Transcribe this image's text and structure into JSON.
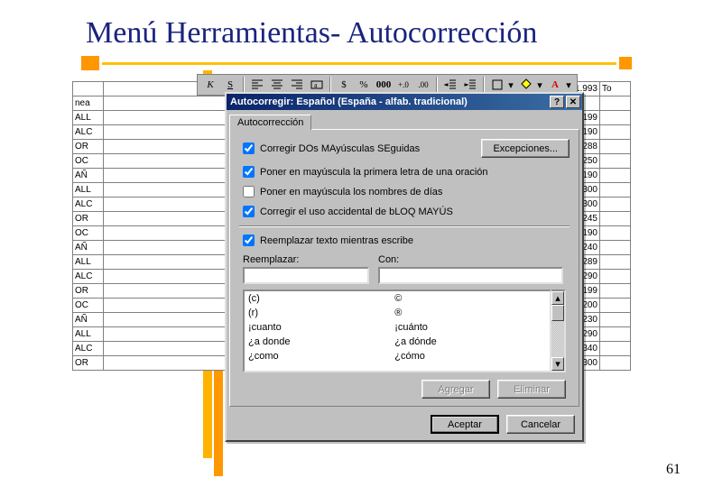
{
  "slide": {
    "title": "Menú Herramientas- Autocorrección",
    "number": "61"
  },
  "toolbar": {
    "icons": [
      "italic",
      "underline",
      "align-left",
      "align-center",
      "align-right",
      "merge",
      "currency",
      "percent",
      "comma",
      "inc-dec",
      "dec-dec",
      "dec-indent",
      "inc-indent",
      "borders",
      "fill",
      "font-color"
    ]
  },
  "sheet": {
    "top_row": {
      "mid": "",
      "right": "1.993",
      "rtext": "To"
    },
    "rows": [
      {
        "l": "nea",
        "r": ""
      },
      {
        "l": "ALL",
        "r": "199"
      },
      {
        "l": "ALC",
        "r": "190"
      },
      {
        "l": "OR",
        "r": "288"
      },
      {
        "l": "OC",
        "r": "250"
      },
      {
        "l": "AÑ",
        "r": "190"
      },
      {
        "l": "ALL",
        "r": "300"
      },
      {
        "l": "ALC",
        "r": "300"
      },
      {
        "l": "OR",
        "r": "245"
      },
      {
        "l": "OC",
        "r": "190"
      },
      {
        "l": "AÑ",
        "r": "240"
      },
      {
        "l": "ALL",
        "r": "289"
      },
      {
        "l": "ALC",
        "r": "290"
      },
      {
        "l": "OR",
        "r": "199"
      },
      {
        "l": "OC",
        "r": "200"
      },
      {
        "l": "AÑ",
        "r": "230"
      },
      {
        "l": "ALL",
        "r": "290"
      },
      {
        "l": "ALC",
        "r": "340"
      },
      {
        "l": "OR",
        "r": "300"
      }
    ]
  },
  "dialog": {
    "title": "Autocorregir: Español (España - alfab. tradicional)",
    "tab": "Autocorrección",
    "checkboxes": {
      "c1": {
        "label": "Corregir DOs MAyúsculas SEguidas",
        "checked": true
      },
      "c2": {
        "label": "Poner en mayúscula la primera letra de una oración",
        "checked": true
      },
      "c3": {
        "label": "Poner en mayúscula los nombres de días",
        "checked": false
      },
      "c4": {
        "label": "Corregir el uso accidental de bLOQ MAYÚS",
        "checked": true
      },
      "c5": {
        "label": "Reemplazar texto mientras escribe",
        "checked": true
      }
    },
    "exceptions_button": "Excepciones...",
    "replace_label": "Reemplazar:",
    "with_label": "Con:",
    "replace_value": "",
    "with_value": "",
    "list": [
      {
        "from": "(c)",
        "to": "©"
      },
      {
        "from": "(r)",
        "to": "®"
      },
      {
        "from": "¡cuanto",
        "to": "¡cuánto"
      },
      {
        "from": "¿a donde",
        "to": "¿a dónde"
      },
      {
        "from": "¿como",
        "to": "¿cómo"
      }
    ],
    "add_button": "Agregar",
    "delete_button": "Eliminar",
    "ok_button": "Aceptar",
    "cancel_button": "Cancelar"
  }
}
